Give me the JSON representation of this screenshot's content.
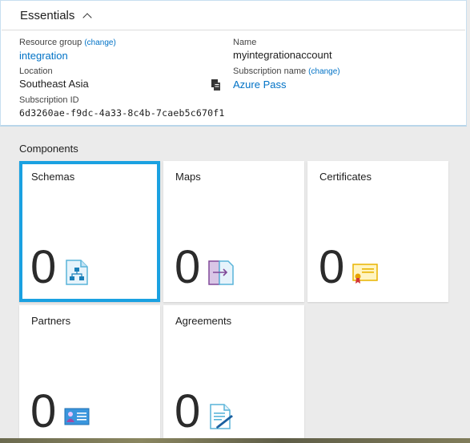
{
  "essentials": {
    "title": "Essentials",
    "resource_group": {
      "label": "Resource group",
      "change": "(change)",
      "value": "integration"
    },
    "location": {
      "label": "Location",
      "value": "Southeast Asia"
    },
    "subscription_id": {
      "label": "Subscription ID",
      "value": "6d3260ae-f9dc-4a33-8c4b-7caeb5c670f1"
    },
    "name": {
      "label": "Name",
      "value": "myintegrationaccount"
    },
    "subscription_name": {
      "label": "Subscription name",
      "change": "(change)",
      "value": "Azure Pass"
    }
  },
  "components": {
    "label": "Components",
    "tiles": [
      {
        "title": "Schemas",
        "count": "0",
        "icon": "schema-icon",
        "selected": true
      },
      {
        "title": "Maps",
        "count": "0",
        "icon": "map-icon"
      },
      {
        "title": "Certificates",
        "count": "0",
        "icon": "certificate-icon"
      },
      {
        "title": "Partners",
        "count": "0",
        "icon": "partner-icon"
      },
      {
        "title": "Agreements",
        "count": "0",
        "icon": "agreement-icon"
      }
    ]
  },
  "colors": {
    "accent": "#1aa1e1",
    "link": "#0072c6",
    "tile_bg": "#ffffff",
    "page_bg": "#ebebeb"
  }
}
